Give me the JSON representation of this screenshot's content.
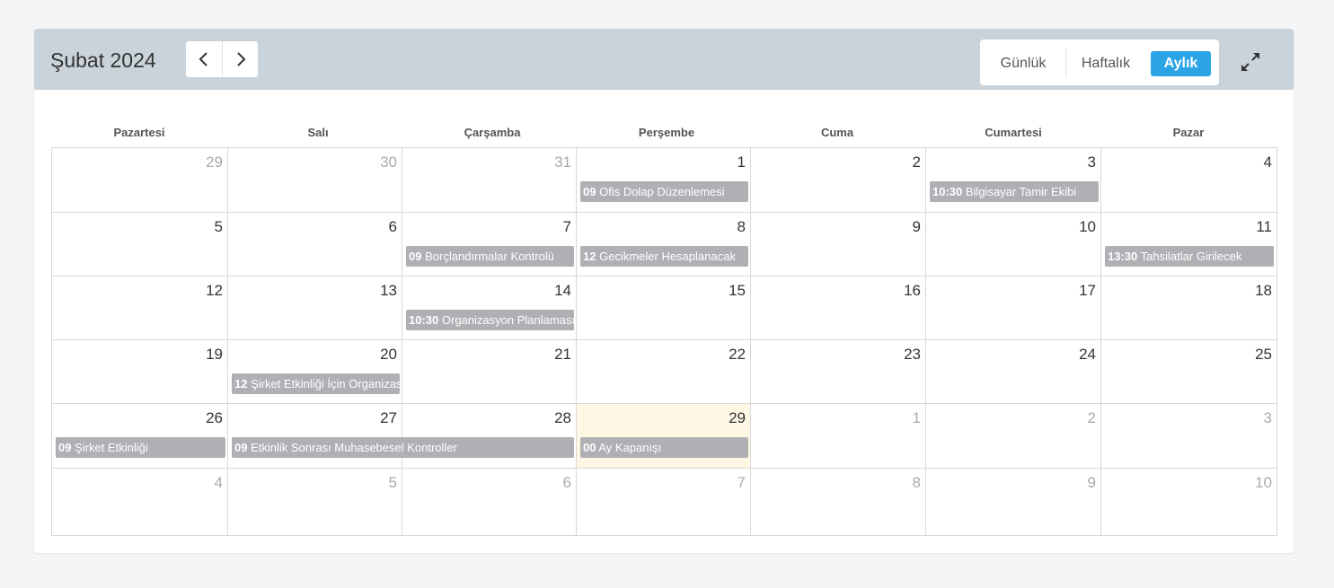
{
  "header": {
    "title": "Şubat 2024",
    "prev_icon": "chevron-left-icon",
    "next_icon": "chevron-right-icon",
    "views": {
      "day": "Günlük",
      "week": "Haftalık",
      "month": "Aylık"
    },
    "active_view": "Aylık",
    "expand_icon": "expand-icon",
    "accent_color": "#2aa4e5",
    "header_color": "#c9d3d9"
  },
  "weekdays": [
    "Pazartesi",
    "Salı",
    "Çarşamba",
    "Perşembe",
    "Cuma",
    "Cumartesi",
    "Pazar"
  ],
  "weeks": [
    [
      "29",
      "30",
      "31",
      "1",
      "2",
      "3",
      "4"
    ],
    [
      "5",
      "6",
      "7",
      "8",
      "9",
      "10",
      "11"
    ],
    [
      "12",
      "13",
      "14",
      "15",
      "16",
      "17",
      "18"
    ],
    [
      "19",
      "20",
      "21",
      "22",
      "23",
      "24",
      "25"
    ],
    [
      "26",
      "27",
      "28",
      "29",
      "1",
      "2",
      "3"
    ],
    [
      "4",
      "5",
      "6",
      "7",
      "8",
      "9",
      "10"
    ]
  ],
  "other_month_days": [
    [
      0,
      0
    ],
    [
      0,
      1
    ],
    [
      0,
      2
    ],
    [
      4,
      4
    ],
    [
      4,
      5
    ],
    [
      4,
      6
    ],
    [
      5,
      0
    ],
    [
      5,
      1
    ],
    [
      5,
      2
    ],
    [
      5,
      3
    ],
    [
      5,
      4
    ],
    [
      5,
      5
    ],
    [
      5,
      6
    ]
  ],
  "today": [
    4,
    3
  ],
  "events": [
    {
      "week": 0,
      "day": 3,
      "span": 1,
      "time": "09",
      "title": "Ofis Dolap Düzenlemesi"
    },
    {
      "week": 0,
      "day": 5,
      "span": 1,
      "time": "10:30",
      "title": "Bilgisayar Tamir Ekibi"
    },
    {
      "week": 1,
      "day": 2,
      "span": 1,
      "time": "09",
      "title": "Borçlandırmalar Kontrolü"
    },
    {
      "week": 1,
      "day": 3,
      "span": 1,
      "time": "12",
      "title": "Gecikmeler Hesaplanacak"
    },
    {
      "week": 1,
      "day": 6,
      "span": 1,
      "time": "13:30",
      "title": "Tahsilatlar Girilecek"
    },
    {
      "week": 2,
      "day": 2,
      "span": 1,
      "time": "10:30",
      "title": "Organizasyon Planlaması"
    },
    {
      "week": 3,
      "day": 1,
      "span": 1,
      "time": "12",
      "title": "Şirket Etkinliği İçin Organizasyon"
    },
    {
      "week": 4,
      "day": 0,
      "span": 1,
      "time": "09",
      "title": "Şirket Etkinliği"
    },
    {
      "week": 4,
      "day": 1,
      "span": 2,
      "time": "09",
      "title": "Etkinlik Sonrası Muhasebesel Kontroller"
    },
    {
      "week": 4,
      "day": 3,
      "span": 1,
      "time": "00",
      "title": "Ay Kapanışı"
    }
  ]
}
